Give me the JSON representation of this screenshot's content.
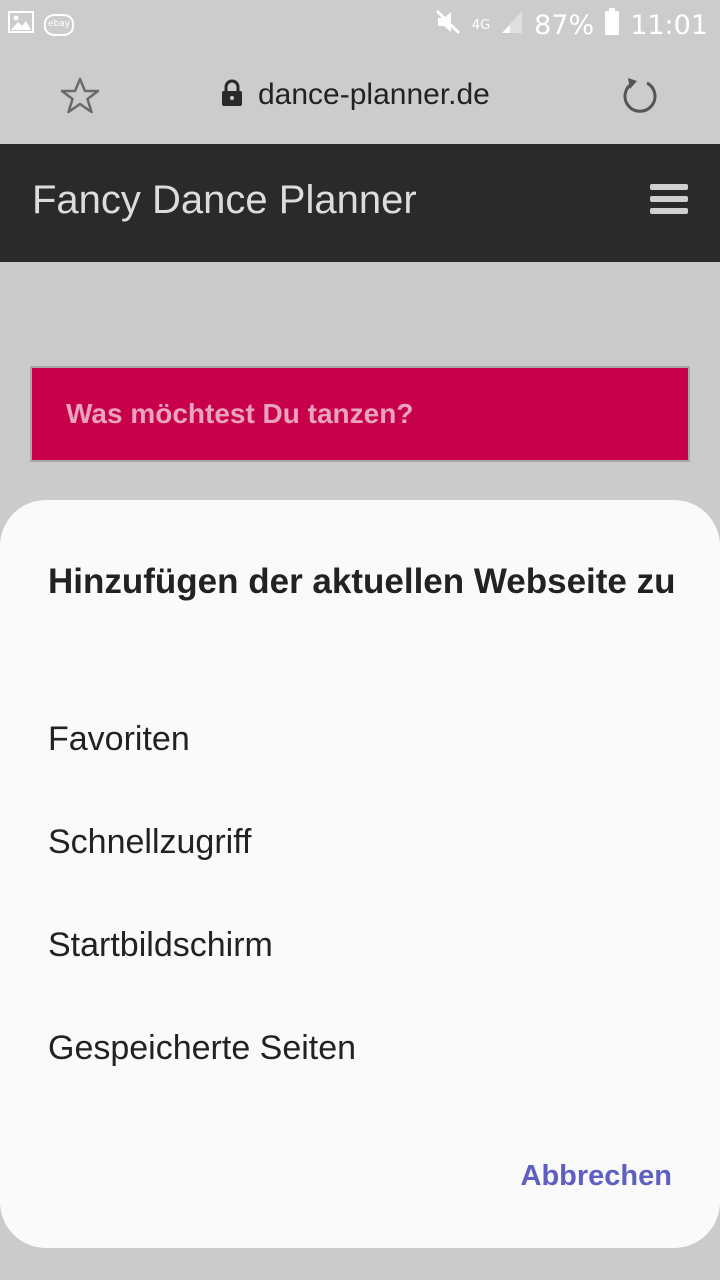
{
  "status_bar": {
    "icons": [
      "gallery-icon",
      "ebay-icon",
      "mute-icon",
      "network-4g-icon",
      "signal-icon",
      "battery-icon"
    ],
    "network_label": "4G",
    "battery_percent": "87%",
    "time": "11:01"
  },
  "browser": {
    "url": "dance-planner.de",
    "icons": [
      "star-icon",
      "lock-icon",
      "reload-icon"
    ]
  },
  "site": {
    "title": "Fancy Dance Planner",
    "menu_icon": "hamburger-icon",
    "banner_text": "Was möchtest Du tanzen?",
    "colors": {
      "header_bg": "#2a2a2a",
      "banner_bg": "#c8004b",
      "banner_text": "#e9a3bd"
    }
  },
  "dialog": {
    "title": "Hinzufügen der aktuellen Webseite zu",
    "options": [
      "Favoriten",
      "Schnellzugriff",
      "Startbildschirm",
      "Gespeicherte Seiten"
    ],
    "cancel_label": "Abbrechen",
    "colors": {
      "accent": "#5e5fc0",
      "sheet_bg": "#fafafa"
    }
  }
}
